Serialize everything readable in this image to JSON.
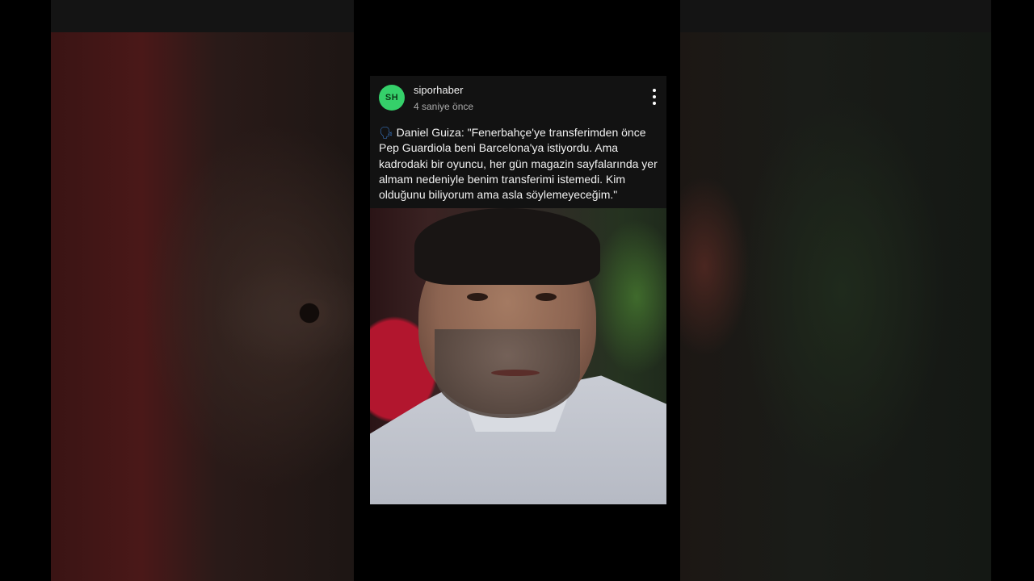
{
  "post": {
    "avatar_initials": "SH",
    "author": "siporhaber",
    "time": "4 saniye önce",
    "emoji": "🗣",
    "text": "Daniel Guiza: \"Fenerbahçe'ye transferimden önce Pep Guardiola beni Barcelona'ya istiyordu. Ama kadrodaki bir oyuncu, her gün magazin sayfalarında yer almam nedeniyle benim transferimi istemedi. Kim olduğunu biliyorum ama asla söylemeyeceğim.\""
  },
  "colors": {
    "avatar": "#35d06a",
    "card": "#121212",
    "background": "#000000"
  }
}
